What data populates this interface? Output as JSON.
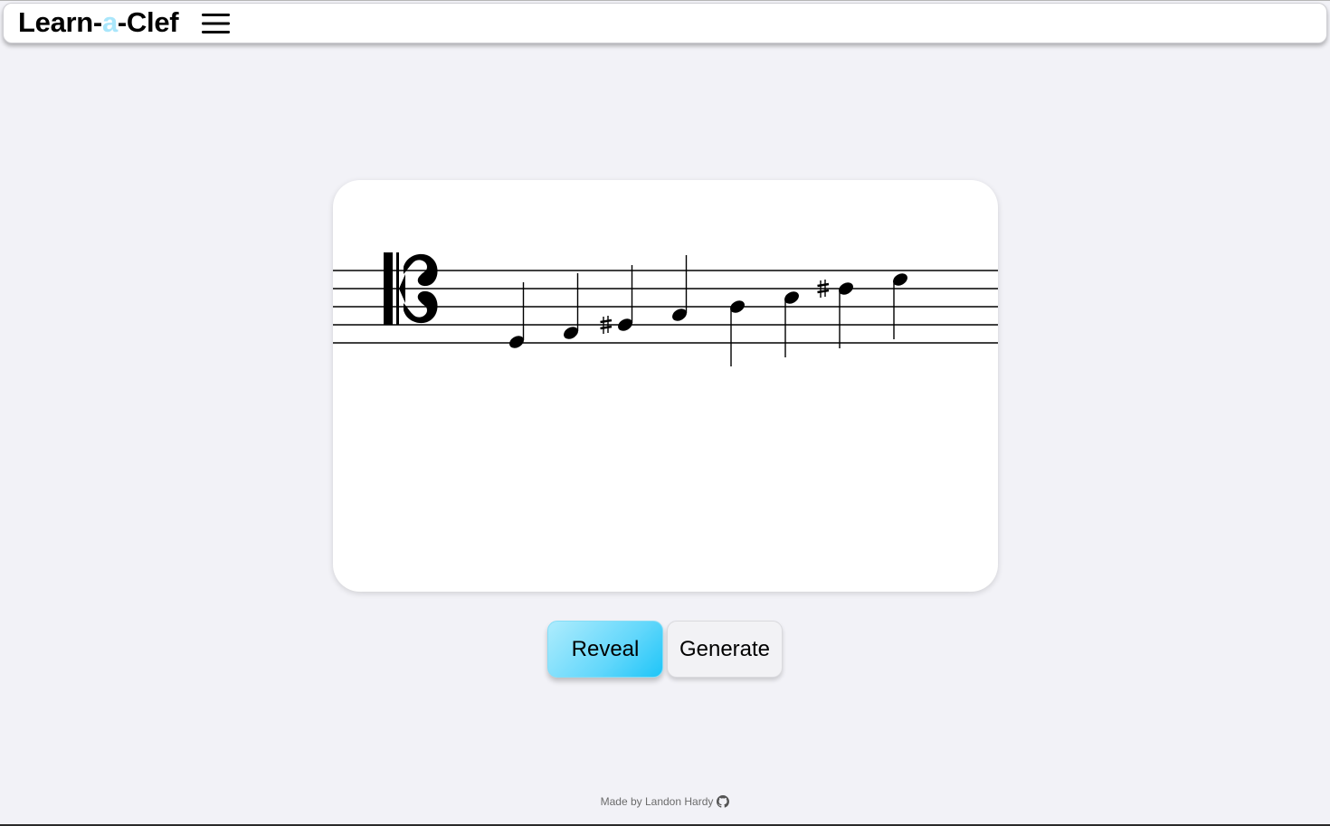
{
  "header": {
    "logo": {
      "part1": "Learn-",
      "part2": "a",
      "part3": "-Clef"
    },
    "menu_icon": "hamburger-menu-icon"
  },
  "staff": {
    "clef": "alto-c-clef",
    "notes": [
      {
        "index": 1,
        "accidental": "",
        "stem": "up"
      },
      {
        "index": 2,
        "accidental": "",
        "stem": "up"
      },
      {
        "index": 3,
        "accidental": "sharp",
        "stem": "up"
      },
      {
        "index": 4,
        "accidental": "",
        "stem": "up"
      },
      {
        "index": 5,
        "accidental": "",
        "stem": "down"
      },
      {
        "index": 6,
        "accidental": "",
        "stem": "down"
      },
      {
        "index": 7,
        "accidental": "sharp",
        "stem": "down"
      },
      {
        "index": 8,
        "accidental": "",
        "stem": "down"
      }
    ]
  },
  "buttons": {
    "reveal": "Reveal",
    "generate": "Generate"
  },
  "footer": {
    "text": "Made by Landon Hardy",
    "icon": "github-icon"
  },
  "colors": {
    "background": "#f2f2f7",
    "logo_accent": "#a9e6fb",
    "reveal_gradient_start": "#aeecfd",
    "reveal_gradient_end": "#1ec5f8",
    "generate_background": "#f2f2f5",
    "card_background": "#ffffff"
  }
}
